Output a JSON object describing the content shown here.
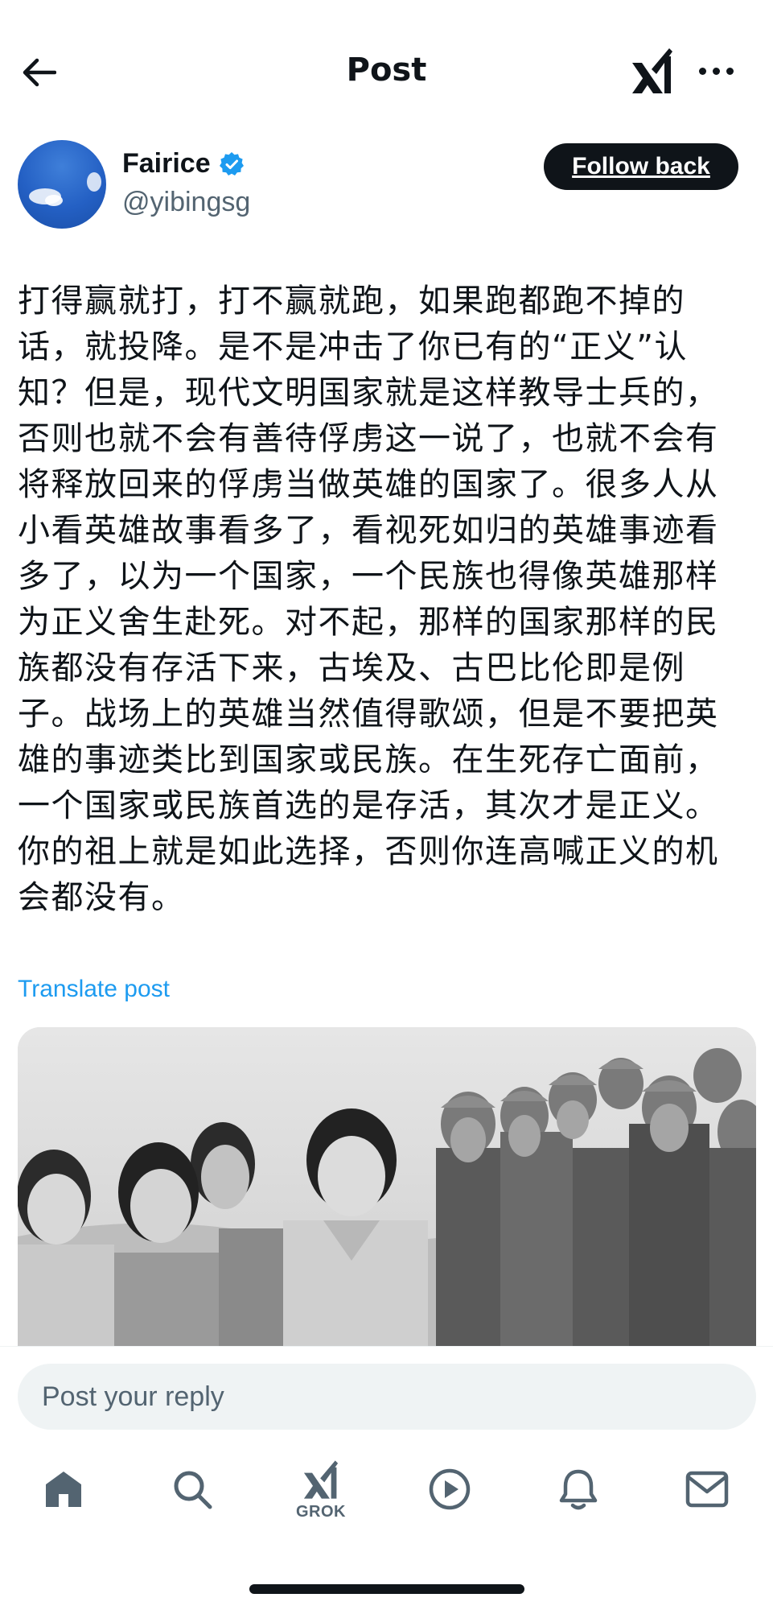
{
  "header": {
    "title": "Post",
    "back_icon": "arrow-left-icon",
    "logo_icon": "xai-logo-icon",
    "more_icon": "more-horizontal-icon"
  },
  "author": {
    "name": "Fairice",
    "handle": "@yibingsg",
    "verified": true,
    "verified_color": "#1d9bf0",
    "follow_label": "Follow back"
  },
  "post": {
    "text": "打得赢就打，打不赢就跑，如果跑都跑不掉的话，就投降。是不是冲击了你已有的“正义”认知？但是，现代文明国家就是这样教导士兵的，否则也就不会有善待俘虏这一说了，也就不会有将释放回来的俘虏当做英雄的国家了。很多人从小看英雄故事看多了，看视死如归的英雄事迹看多了，以为一个国家，一个民族也得像英雄那样为正义舍生赴死。对不起，那样的国家那样的民族都没有存活下来，古埃及、古巴比伦即是例子。战场上的英雄当然值得歌颂，但是不要把英雄的事迹类比到国家或民族。在生死存亡面前，一个国家或民族首选的是存活，其次才是正义。你的祖上就是如此选择，否则你连高喊正义的机会都没有。",
    "translate_label": "Translate post",
    "link_color": "#1d9bf0"
  },
  "reply": {
    "placeholder": "Post your reply"
  },
  "nav": {
    "items": [
      {
        "icon": "home-icon"
      },
      {
        "icon": "search-icon"
      },
      {
        "icon": "grok-icon",
        "label": "GROK"
      },
      {
        "icon": "video-icon"
      },
      {
        "icon": "notifications-icon"
      },
      {
        "icon": "messages-icon"
      }
    ]
  }
}
